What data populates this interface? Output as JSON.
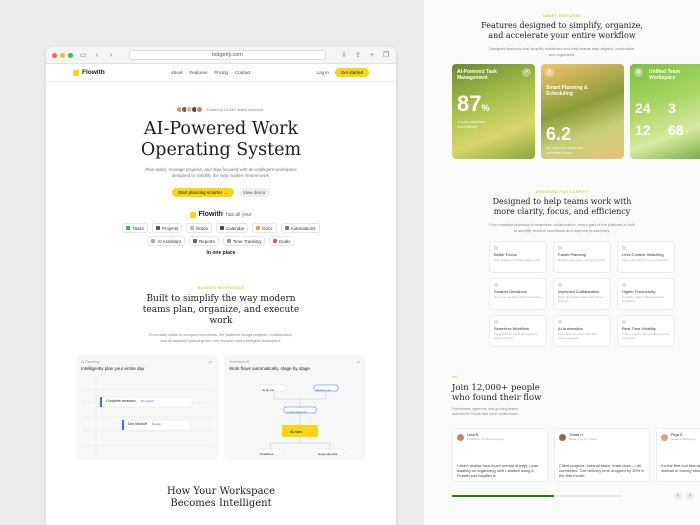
{
  "browser": {
    "url": "ledgerly.com"
  },
  "nav": {
    "brand": "Flowith",
    "links": [
      "About",
      "Features",
      "Pricing",
      "Contact"
    ],
    "login": "Log in",
    "cta": "Get started"
  },
  "hero": {
    "trusted": "Trusted by 10,000+ teams worldwide",
    "title_line1": "AI-Powered Work",
    "title_line2": "Operating System",
    "subtitle": "Plan tasks, manage projects, and stay focused with an intelligent workspace designed to simplify the way modern teams work.",
    "primary_cta": "Start planning smarter →",
    "secondary_cta": "View demo"
  },
  "has_all": {
    "brand": "Flowith",
    "text": "has all your",
    "chips": [
      "Tasks",
      "Projects",
      "Notes",
      "Calendar",
      "Docs",
      "Automations",
      "AI Assistant",
      "Reports",
      "Time Tracking",
      "Goals"
    ],
    "footer": "in one place"
  },
  "section2": {
    "eyebrow": "Modern Workspace",
    "title": "Built to simplify the way modern teams plan, organize, and execute work",
    "desc": "From daily tasks to complex workflows, the platform brings projects, collaboration, and AI-assisted planning into one focused and intelligent workspace.",
    "panel1": {
      "tag": "AI Planning",
      "title": "Intelligently plan your entire day",
      "task1": "Complete research",
      "task1_tag": "Research",
      "task2": "Doc handoff",
      "task2_tag": "Design"
    },
    "panel2": {
      "tag": "Workflows AI",
      "title": "Work flows automatically, stage by stage",
      "n1": "To do (4)",
      "n2": "Review (2)",
      "n3": "In Progress (3)",
      "n4": "AI-rules",
      "n5": "Deadlines",
      "n6": "Dependencies"
    }
  },
  "section3": {
    "title_line1": "How Your Workspace",
    "title_line2": "Becomes Intelligent"
  },
  "right": {
    "feature_eyebrow": "Smart Features",
    "feature_title": "Features designed to simplify, organize, and accelerate your entire workflow",
    "feature_desc": "Designed features that simplify workflows and help teams stay aligned, productive, and organized.",
    "cards": [
      {
        "title": "AI-Powered Task Management",
        "stat": "87",
        "unit": "%",
        "note": "of tasks organized automatically"
      },
      {
        "title": "Smart Planning & Scheduling",
        "stat": "6.2",
        "unit": "",
        "note": "hrs saved per week with automated plans"
      },
      {
        "title": "Unified Team Workspace",
        "stat": "24",
        "unit": "",
        "stats_extra": [
          "3",
          "12",
          "68"
        ],
        "note": ""
      }
    ],
    "clarity_eyebrow": "Designed for Clarity",
    "clarity_title": "Designed to help teams work with more clarity, focus, and efficiency",
    "clarity_desc": "From smarter planning to seamless collaboration, every part of the platform is built to simplify modern workflows and improve productivity.",
    "grid": [
      {
        "title": "Better Focus",
        "desc": "Stay aligned on what matters most"
      },
      {
        "title": "Faster Planning",
        "desc": "Reduce time spent organizing work"
      },
      {
        "title": "Less Context Switching",
        "desc": "Keep everything in one workspace"
      },
      {
        "title": "Smarter Decisions",
        "desc": "Use AI to prioritize what's important"
      },
      {
        "title": "Improved Collaboration",
        "desc": "Work alongside teams with shared projects"
      },
      {
        "title": "Higher Productivity",
        "desc": "Complete tasks with automated workflows"
      },
      {
        "title": "Seamless Workflow",
        "desc": "Move through tasks and projects without friction"
      },
      {
        "title": "AI Automation",
        "desc": "Automate repetitive work and routine updates"
      },
      {
        "title": "Real-Time Visibility",
        "desc": "Track progress and updates across your team"
      }
    ],
    "join_mark": "“”",
    "join_title_line1": "Join 12,000+ people",
    "join_title_line2": "who found their flow",
    "join_desc": "Freelancers, agencies, and growing teams switched to Flowith and never looked back.",
    "testimonials": [
      {
        "name": "Lena R.",
        "role": "Freelance Product Designer",
        "quote": "I didn't realise how much mental energy I was wasting on organizing until I started using it. Flowith just handles it."
      },
      {
        "name": "Tomas H.",
        "role": "Head, Agency Owner",
        "quote": "Client projects, internal tasks, team docs — all connected. Our delivery time dropped by 30% in the first month."
      },
      {
        "name": "Priya S.",
        "role": "Head of Marketing",
        "quote": "It's the first tool that adapts to how I work instead of forcing structure."
      }
    ],
    "progress": 0.6
  },
  "colors": {
    "accent": "#f6d617",
    "progress": "#2c7a17"
  }
}
